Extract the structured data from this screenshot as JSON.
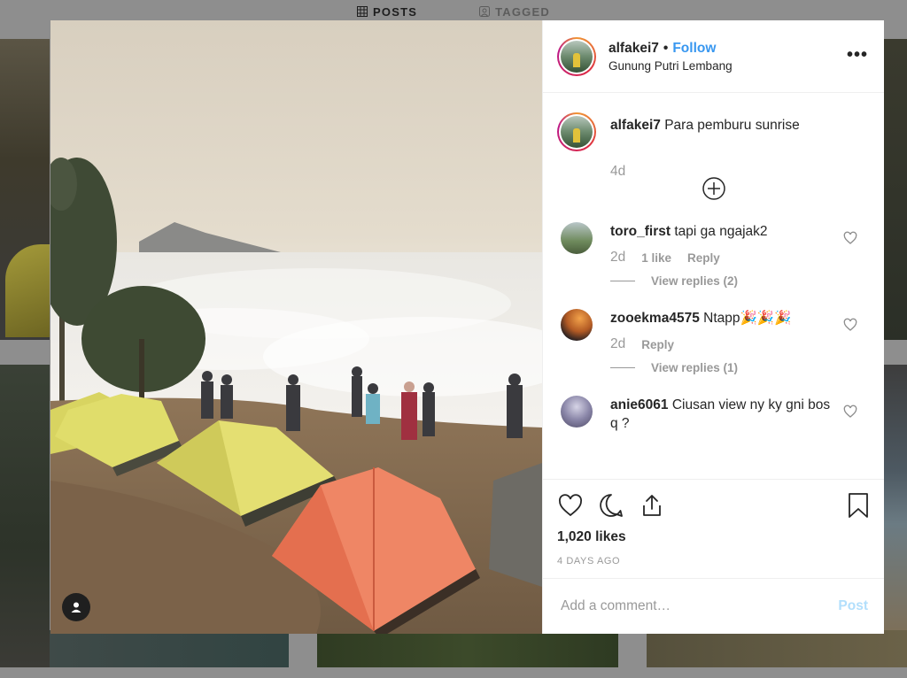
{
  "profile_tabs": [
    {
      "label": "POSTS",
      "icon": "grid-icon"
    },
    {
      "label": "TAGGED",
      "icon": "tag-user-icon"
    }
  ],
  "post": {
    "username": "alfakei7",
    "separator": "•",
    "follow_label": "Follow",
    "location": "Gunung Putri Lembang",
    "more_icon": "more-options-icon",
    "caption": {
      "username": "alfakei7",
      "text": "Para pemburu sunrise",
      "time": "4d"
    },
    "load_more_icon": "plus-circle-icon",
    "comments": [
      {
        "username": "toro_first",
        "text": "tapi ga ngajak2",
        "time": "2d",
        "likes": "1 like",
        "reply": "Reply",
        "view_replies": "View replies (2)"
      },
      {
        "username": "zooekma4575",
        "text": "Ntapp🎉🎉🎉",
        "time": "2d",
        "likes": "",
        "reply": "Reply",
        "view_replies": "View replies (1)"
      },
      {
        "username": "anie6061",
        "text": "Ciusan view ny ky gni bos q ?",
        "time": "",
        "likes": "",
        "reply": "",
        "view_replies": ""
      }
    ],
    "likes_count": "1,020 likes",
    "posted_ago": "4 DAYS AGO",
    "add_comment_placeholder": "Add a comment…",
    "post_label": "Post"
  },
  "colors": {
    "follow": "#3897f0",
    "post_disabled": "#b2dffc",
    "muted_text": "#999999",
    "overlay": "#8e8e8e"
  }
}
